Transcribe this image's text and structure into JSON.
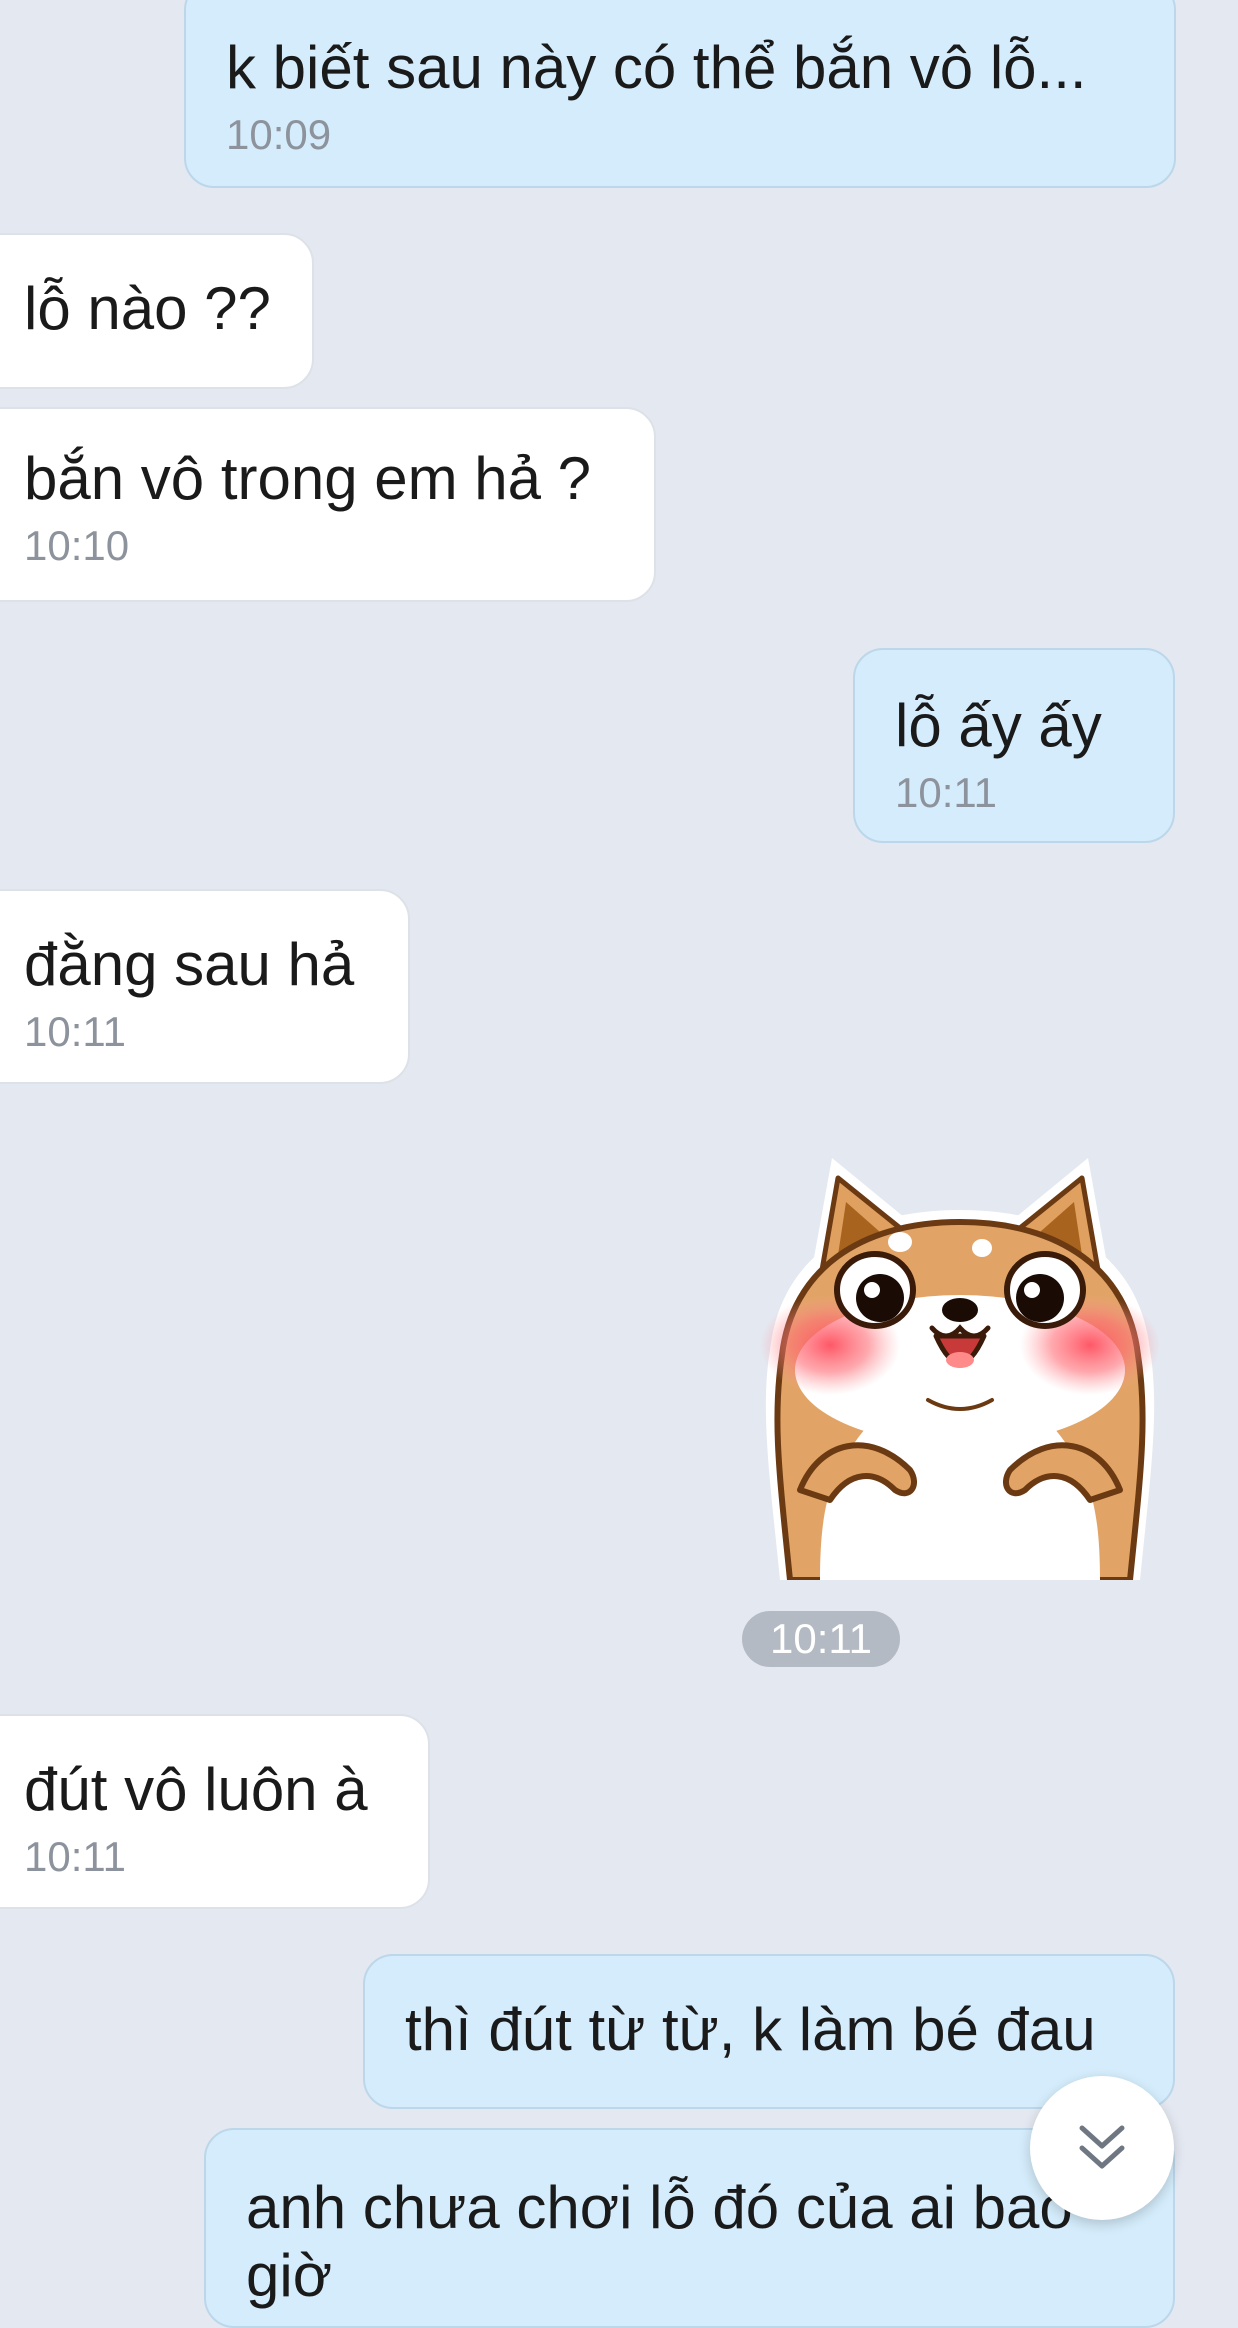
{
  "messages": [
    {
      "text": "k biết sau này có thể bắn vô lỗ...",
      "time": "10:09"
    },
    {
      "text": "lỗ nào ??"
    },
    {
      "text": "bắn vô trong em hả ?",
      "time": "10:10"
    },
    {
      "text": "lỗ ấy ấy",
      "time": "10:11"
    },
    {
      "text": "đằng sau hả",
      "time": "10:11"
    },
    {
      "text": "đút vô luôn à",
      "time": "10:11"
    },
    {
      "text": "thì đút từ từ, k làm bé đau"
    },
    {
      "text": "anh chưa chơi lỗ đó của ai bao giờ"
    }
  ],
  "sticker": {
    "icon": "shiba-dog-blushing-sticker",
    "time": "10:11"
  },
  "scroll_button": {
    "icon": "double-chevron-down-icon"
  },
  "colors": {
    "background": "#e4e8f1",
    "incoming_bubble": "#ffffff",
    "outgoing_bubble": "#d4ecfb",
    "time_text": "#8d939c"
  }
}
